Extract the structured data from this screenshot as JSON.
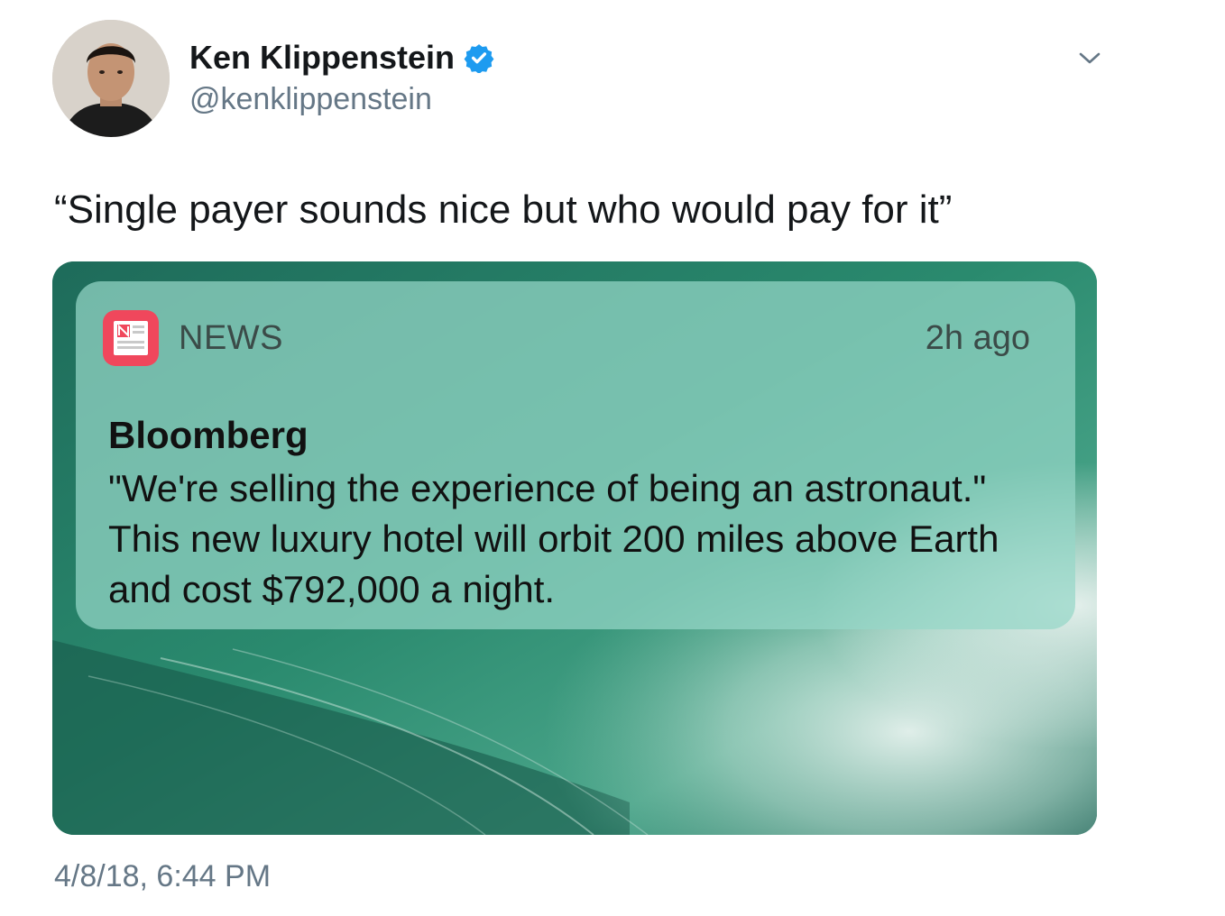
{
  "tweet": {
    "author": {
      "display_name": "Ken Klippenstein",
      "handle": "@kenklippenstein",
      "verified": true,
      "avatar_icon": "user-avatar"
    },
    "menu_icon": "chevron-down-icon",
    "text": "“Single payer sounds nice but who would pay for it”",
    "timestamp": "4/8/18, 6:44 PM"
  },
  "notification": {
    "app_name": "NEWS",
    "app_icon": "news-app-icon",
    "time": "2h ago",
    "title": "Bloomberg",
    "body": "\"We're selling the experience of being an astronaut.\" This new luxury hotel will orbit 200 miles above Earth and cost $792,000 a night."
  },
  "colors": {
    "verified_badge": "#1da1f2",
    "secondary_text": "#657786",
    "news_icon": "#f0475c"
  }
}
